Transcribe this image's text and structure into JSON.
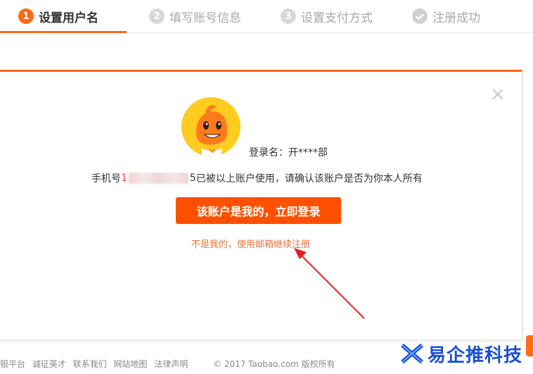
{
  "steps": [
    {
      "num": "1",
      "label": "设置用户名"
    },
    {
      "num": "2",
      "label": "填写账号信息"
    },
    {
      "num": "3",
      "label": "设置支付方式"
    },
    {
      "num": "",
      "label": "注册成功"
    }
  ],
  "dialog": {
    "close_icon": "×",
    "login_name_label": "登录名：开****部",
    "phone_prefix": "手机号",
    "phone_visible_start": "1",
    "phone_visible_end": "5",
    "phone_suffix": " 已被以上账户使用，请确认该账户是否为你本人所有",
    "login_button": "该账户是我的，立即登录",
    "email_link": "不是我的，使用邮箱继续注册"
  },
  "footer": {
    "links": [
      "银平台",
      "诚征英才",
      "联系我们",
      "网站地图",
      "法律声明"
    ],
    "copyright": "© 2017 Taobao.com 版权所有"
  },
  "watermark": {
    "text": "易企推科技"
  },
  "colors": {
    "accent": "#ff6a13",
    "button": "#ff5000",
    "link": "#e8733f",
    "arrow": "#e02020",
    "watermark": "#1a4fd6"
  }
}
